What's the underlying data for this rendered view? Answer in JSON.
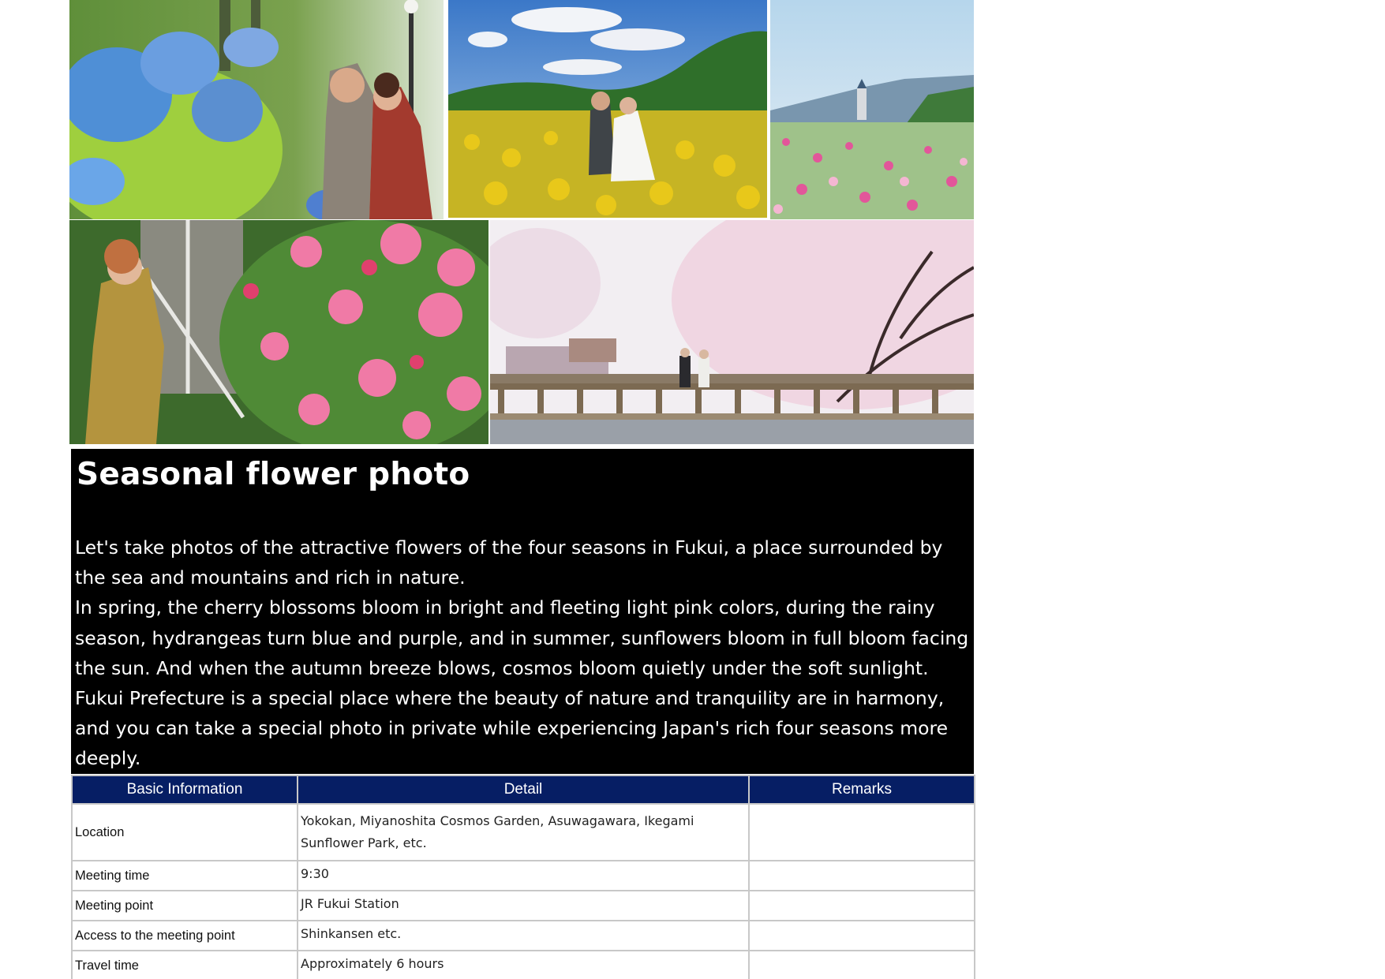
{
  "section": {
    "title": "Seasonal flower photo",
    "paragraphs": [
      "Let's take photos of the attractive flowers of the four seasons in Fukui, a place surrounded by the sea and mountains and rich in nature.",
      "In spring, the cherry blossoms bloom in bright and fleeting light pink colors, during the rainy season, hydrangeas turn blue and purple, and in summer, sunflowers bloom in full bloom facing the sun. And when the autumn breeze blows, cosmos bloom quietly under the soft sunlight.",
      "Fukui Prefecture is a special place where the beauty of nature and tranquility are in harmony, and you can take a special photo in private while experiencing Japan's rich four seasons more deeply."
    ]
  },
  "table": {
    "headers": [
      "Basic Information",
      "Detail",
      "Remarks"
    ],
    "rows": [
      {
        "label": "Location",
        "detail": "Yokokan, Miyanoshita Cosmos Garden, Asuwagawara, Ikegami Sunflower Park, etc.",
        "remarks": ""
      },
      {
        "label": "Meeting time",
        "detail": "9:30",
        "remarks": ""
      },
      {
        "label": "Meeting point",
        "detail": "JR Fukui Station",
        "remarks": ""
      },
      {
        "label": "Access to the meeting point",
        "detail": "Shinkansen etc.",
        "remarks": ""
      },
      {
        "label": "Travel time",
        "detail": "Approximately 6 hours",
        "remarks": ""
      }
    ]
  },
  "colors": {
    "header_bg": "#061e64",
    "description_bg": "#000000",
    "border": "#c8c8c8"
  }
}
